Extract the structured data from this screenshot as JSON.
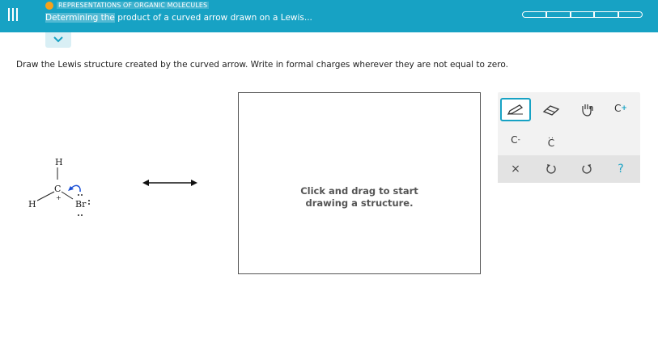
{
  "header": {
    "topic": "REPRESENTATIONS OF ORGANIC MOLECULES",
    "title_highlight": "Determining the",
    "title_rest": " product of a curved arrow drawn on a Lewis...",
    "progress_segments": 5,
    "progress_filled": 0
  },
  "instructions": "Draw the Lewis structure created by the curved arrow. Write in formal charges wherever they are not equal to zero.",
  "molecule": {
    "atoms": {
      "h_top": "H",
      "carbon": "C",
      "h_left": "H",
      "bromine": "Br",
      "charge": "+"
    }
  },
  "draw_area": {
    "hint_line1": "Click and drag to start",
    "hint_line2": "drawing a structure."
  },
  "toolbar": {
    "charge_atom": "C",
    "charge_sup": "+",
    "neg_atom": "C",
    "neg_sup": "-",
    "lone_pair_atom": "C",
    "lone_pair_dots": "..",
    "clear_symbol": "×",
    "help_symbol": "?"
  },
  "colors": {
    "header_bg": "#17a2c4",
    "accent": "#17a2c4",
    "topic_dot": "#f7a21b",
    "curved_arrow": "#1b4fd6"
  }
}
